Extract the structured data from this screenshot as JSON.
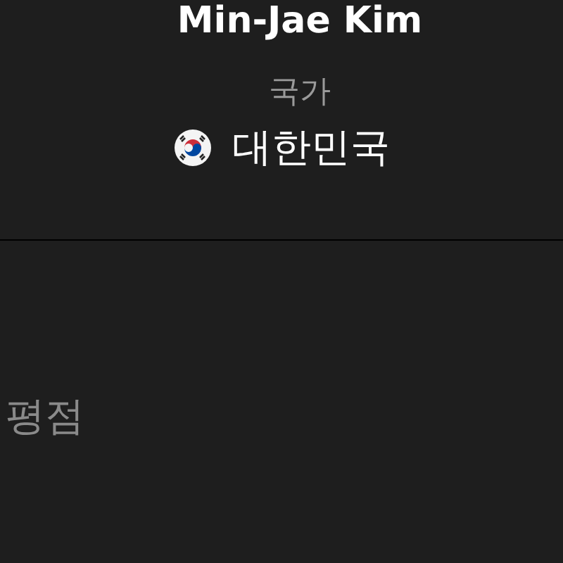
{
  "profile": {
    "name": "Min-Jae Kim",
    "country_label": "국가",
    "country": "대한민국"
  },
  "rating": {
    "label": "평점"
  }
}
